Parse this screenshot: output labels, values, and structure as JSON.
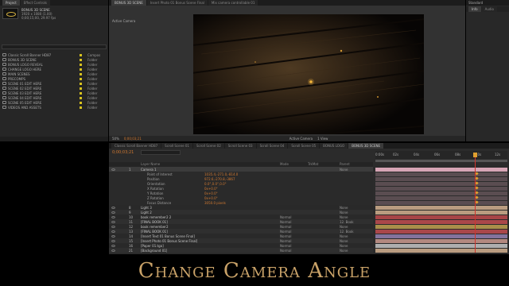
{
  "project_panel": {
    "tabs": [
      "Project",
      "Effect Controls"
    ],
    "item_title": "BONUS 3D SCENE",
    "item_info": [
      "1920 x 1080 (1.00)",
      "0;00;15;00, 29.97 fps"
    ],
    "items": [
      {
        "name": "Classic Scroll Banner HD87",
        "type": "Compos"
      },
      {
        "name": "BONUS 3D SCENE",
        "type": "Folder"
      },
      {
        "name": "BONUS LOGO REVEAL",
        "type": "Folder"
      },
      {
        "name": "CHANGE LOGO HERE",
        "type": "Folder"
      },
      {
        "name": "MAIN SCENES",
        "type": "Folder"
      },
      {
        "name": "PRECOMPS",
        "type": "Folder"
      },
      {
        "name": "SCENE 01 EDIT HERE",
        "type": "Folder"
      },
      {
        "name": "SCENE 02 EDIT HERE",
        "type": "Folder"
      },
      {
        "name": "SCENE 03 EDIT HERE",
        "type": "Folder"
      },
      {
        "name": "SCENE 04 EDIT HERE",
        "type": "Folder"
      },
      {
        "name": "SCENE 05 EDIT HERE",
        "type": "Folder"
      },
      {
        "name": "VIDEOS AND ASSETS",
        "type": "Folder"
      }
    ]
  },
  "comp_panel": {
    "tabs": [
      "BONUS 3D SCENE",
      "Insert Photo 01 Bonus Scene Final",
      "Mix camera controllable 01"
    ],
    "view_label": "Active Camera",
    "zoom": "50%",
    "timecode": "0;00;03;21",
    "view_mode": "Active Camera",
    "views": "1 View"
  },
  "right_panel": {
    "label": "Standard",
    "tabs": [
      "Info",
      "Audio"
    ]
  },
  "timeline": {
    "tabs": [
      "Classic Scroll Banner HD87",
      "Scroll Scene 01",
      "Scroll Scene 02",
      "Scroll Scene 03",
      "Scroll Scene 04",
      "Scroll Scene 05",
      "BONUS LOGO",
      "BONUS 3D SCENE"
    ],
    "timecode": "0;00;03;21",
    "ruler": [
      "0:00s",
      "02s",
      "04s",
      "06s",
      "08s",
      "10s",
      "12s"
    ],
    "columns": {
      "source": "Layer Name",
      "mode": "Mode",
      "trkmat": "TrkMat",
      "parent": "Parent"
    },
    "layers": [
      {
        "index": "1",
        "name": "Camera 1",
        "value": "",
        "mode": "",
        "parent": "None",
        "type": "camera"
      },
      {
        "index": "",
        "name": "Point of Interest",
        "value": "1035.4,-271.0,-814.0",
        "mode": "",
        "parent": "",
        "type": "prop"
      },
      {
        "index": "",
        "name": "Position",
        "value": "972.6,-270.8,-3867",
        "mode": "",
        "parent": "",
        "type": "prop"
      },
      {
        "index": "",
        "name": "Orientation",
        "value": "0.0°,0.0°,0.0°",
        "mode": "",
        "parent": "",
        "type": "prop"
      },
      {
        "index": "",
        "name": "X Rotation",
        "value": "0x+0.0°",
        "mode": "",
        "parent": "",
        "type": "prop"
      },
      {
        "index": "",
        "name": "Y Rotation",
        "value": "0x+0.0°",
        "mode": "",
        "parent": "",
        "type": "prop"
      },
      {
        "index": "",
        "name": "Z Rotation",
        "value": "0x+0.0°",
        "mode": "",
        "parent": "",
        "type": "prop"
      },
      {
        "index": "",
        "name": "Focus Distance",
        "value": "3050.0 pixels",
        "mode": "",
        "parent": "",
        "type": "prop"
      },
      {
        "index": "8",
        "name": "Light 3",
        "value": "",
        "mode": "",
        "parent": "None",
        "type": "light"
      },
      {
        "index": "9",
        "name": "Light 2",
        "value": "",
        "mode": "",
        "parent": "None",
        "type": "light"
      },
      {
        "index": "10",
        "name": "book remember2 2",
        "value": "",
        "mode": "Normal",
        "parent": "None",
        "type": "layer"
      },
      {
        "index": "11",
        "name": "[FINAL BOOK 01]",
        "value": "",
        "mode": "Normal",
        "parent": "12. Book",
        "type": "layer"
      },
      {
        "index": "12",
        "name": "book remember2",
        "value": "",
        "mode": "Normal",
        "parent": "None",
        "type": "layer"
      },
      {
        "index": "13",
        "name": "[FINAL BOOK 01]",
        "value": "",
        "mode": "Normal",
        "parent": "12. Book",
        "type": "layer"
      },
      {
        "index": "14",
        "name": "[Insert Text 01 Bonus Scene Final]",
        "value": "",
        "mode": "Normal",
        "parent": "None",
        "type": "layer"
      },
      {
        "index": "15",
        "name": "[Insert Photo 01 Bonus Scene Final]",
        "value": "",
        "mode": "Normal",
        "parent": "None",
        "type": "layer"
      },
      {
        "index": "16",
        "name": "[Paper 01.tga]",
        "value": "",
        "mode": "Normal",
        "parent": "None",
        "type": "layer"
      },
      {
        "index": "21",
        "name": "[Background 01]",
        "value": "",
        "mode": "Normal",
        "parent": "None",
        "type": "layer"
      }
    ],
    "bar_colors": [
      "#e9b3c4",
      "#e9b3c4",
      "#e9b3c4",
      "#e9b3c4",
      "#e9b3c4",
      "#e9b3c4",
      "#e9b3c4",
      "#e9b3c4",
      "#c9a88a",
      "#c9a88a",
      "#b5484a",
      "#b84a4e",
      "#b8994e",
      "#b84a4e",
      "#8e7ba8",
      "#c2938a",
      "#bdbcbc",
      "#c9a88a"
    ]
  },
  "caption": "Change Camera Angle",
  "colors": {
    "accent_orange": "#d07830",
    "playhead": "#d0342c",
    "caption_gold": "#c9a268"
  }
}
